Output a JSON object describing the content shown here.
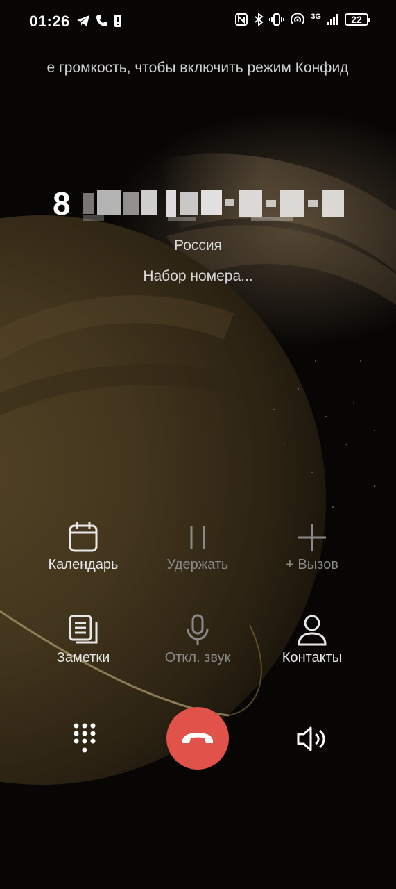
{
  "status_bar": {
    "time": "01:26",
    "network": "3G",
    "battery": "22"
  },
  "ticker": {
    "text": "е громкость, чтобы включить режим Конфид"
  },
  "call": {
    "number_prefix": "8",
    "country": "Россия",
    "status": "Набор номера..."
  },
  "actions": [
    {
      "label": "Календарь",
      "icon": "calendar-icon",
      "enabled": true
    },
    {
      "label": "Удержать",
      "icon": "pause-icon",
      "enabled": false
    },
    {
      "label": "+ Вызов",
      "icon": "plus-icon",
      "enabled": false
    },
    {
      "label": "Заметки",
      "icon": "notes-icon",
      "enabled": true
    },
    {
      "label": "Откл. звук",
      "icon": "microphone-icon",
      "enabled": false
    },
    {
      "label": "Контакты",
      "icon": "contact-icon",
      "enabled": true
    }
  ],
  "bottom": {
    "dialpad_icon": "dialpad-icon",
    "end_call_icon": "end-call-icon",
    "speaker_icon": "speaker-icon"
  },
  "colors": {
    "end_call": "#e0524a",
    "active_text": "#e8e8e8",
    "disabled_text": "#8a8a8a",
    "background": "#0b0907"
  }
}
